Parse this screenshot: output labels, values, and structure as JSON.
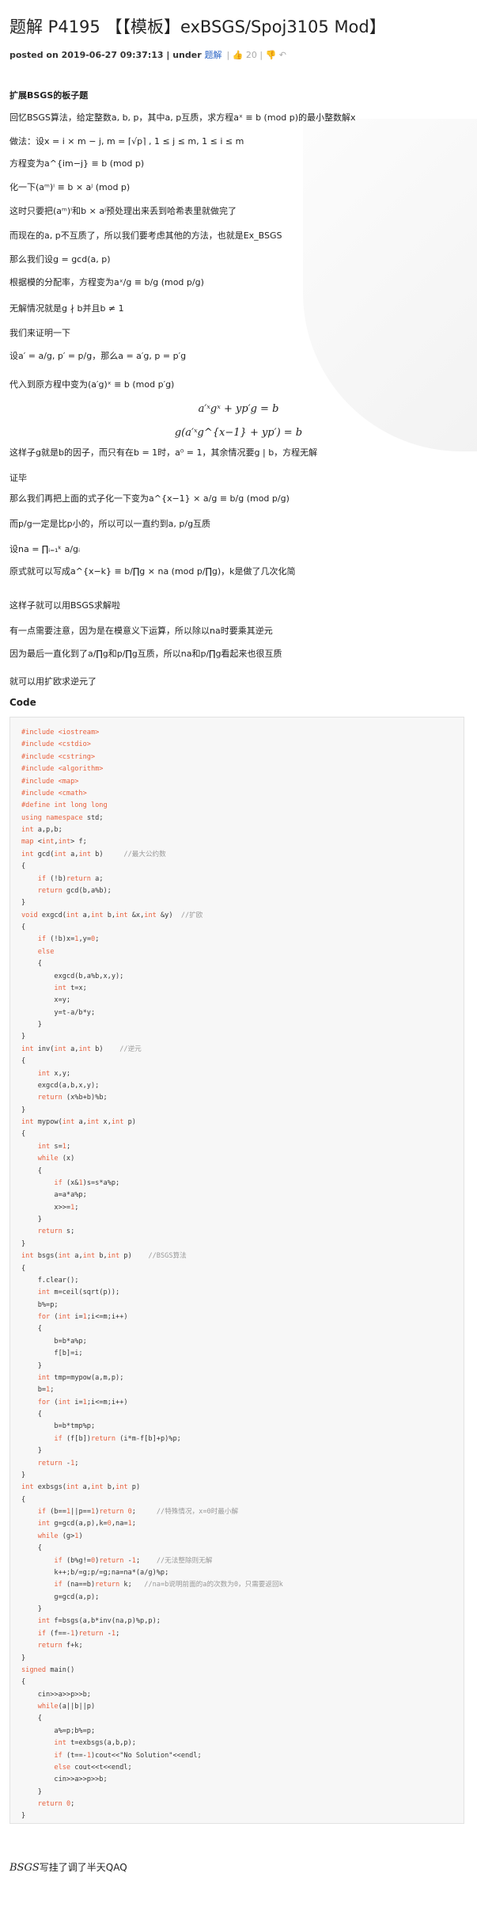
{
  "post": {
    "title": "题解 P4195 【【模板】exBSGS/Spoj3105 Mod】",
    "meta_posted": "posted on 2019-06-27 09:37:13 | under ",
    "meta_category": "题解",
    "meta_likes": "| 👍 20 | 👎 ↶"
  },
  "body": [
    {
      "text": "扩展BSGS的板子题",
      "bold": true
    },
    {
      "text": "回忆BSGS算法，给定整数a, b, p，其中a, p互质，求方程aˣ ≡ b (mod p)的最小整数解x"
    },
    {
      "text": "做法：设x = i × m − j, m = ⌈√p⌉ , 1 ≤ j ≤ m, 1 ≤ i ≤ m",
      "bold_prefix": "做法："
    },
    {
      "text": "方程变为a^{im−j} ≡ b (mod p)"
    },
    {
      "text": "化一下(aᵐ)ⁱ ≡ b × aʲ (mod p)"
    },
    {
      "text": "这时只要把(aᵐ)ⁱ和b × aʲ预处理出来丢到哈希表里就做完了"
    },
    {
      "text": "而现在的a, p不互质了，所以我们要考虑其他的方法，也就是Ex_BSGS"
    },
    {
      "text": "那么我们设g = gcd(a, p)"
    },
    {
      "text": "根据模的分配率，方程变为aˣ/g ≡ b/g (mod p/g)"
    },
    {
      "text": "无解情况就是g ∤ b并且b ≠ 1"
    },
    {
      "text": "我们来证明一下"
    },
    {
      "text": "设a′ = a/g, p′ = p/g，那么a = a′g, p = p′g"
    },
    {
      "text": "代入到原方程中变为(a′g)ˣ ≡ b (mod p′g)"
    },
    {
      "text": "a′ˣgˣ + yp′g = b",
      "center": true
    },
    {
      "text": "g(a′ˣg^{x−1} + yp′) = b",
      "center": true
    },
    {
      "text": "这样子g就是b的因子，而只有在b = 1时，a⁰ = 1，其余情况要g | b，方程无解"
    },
    {
      "text": "证毕"
    },
    {
      "text": "那么我们再把上面的式子化一下变为a^{x−1} × a/g ≡ b/g (mod p/g)"
    },
    {
      "text": "而p/g一定是比p小的，所以可以一直约到a, p/g互质"
    },
    {
      "text": "设na = ∏ᵢ₌₁ᵏ a/gᵢ"
    },
    {
      "text": "原式就可以写成a^{x−k} ≡ b/∏g × na (mod p/∏g)，k是做了几次化简"
    },
    {
      "text": "这样子就可以用BSGS求解啦"
    },
    {
      "text": "有一点需要注意，因为是在模意义下运算，所以除以na时要乘其逆元"
    },
    {
      "text": "因为最后一直化到了a/∏g和p/∏g互质，所以na和p/∏g看起来也很互质"
    },
    {
      "text": "就可以用扩欧求逆元了"
    }
  ],
  "code_heading": "Code",
  "code": [
    "#include <iostream>",
    "#include <cstdio>",
    "#include <cstring>",
    "#include <algorithm>",
    "#include <map>",
    "#include <cmath>",
    "#define int long long",
    "using namespace std;",
    "int a,p,b;",
    "map <int,int> f;",
    "int gcd(int a,int b)     //最大公约数",
    "{",
    "    if (!b)return a;",
    "    return gcd(b,a%b);",
    "}",
    "void exgcd(int a,int b,int &x,int &y)  //扩欧",
    "{",
    "    if (!b)x=1,y=0;",
    "    else",
    "    {",
    "        exgcd(b,a%b,x,y);",
    "        int t=x;",
    "        x=y;",
    "        y=t-a/b*y;",
    "    }",
    "}",
    "int inv(int a,int b)    //逆元",
    "{",
    "    int x,y;",
    "    exgcd(a,b,x,y);",
    "    return (x%b+b)%b;",
    "}",
    "int mypow(int a,int x,int p)",
    "{",
    "    int s=1;",
    "    while (x)",
    "    {",
    "        if (x&1)s=s*a%p;",
    "        a=a*a%p;",
    "        x>>=1;",
    "    }",
    "    return s;",
    "}",
    "int bsgs(int a,int b,int p)    //BSGS算法",
    "{",
    "    f.clear();",
    "    int m=ceil(sqrt(p));",
    "    b%=p;",
    "    for (int i=1;i<=m;i++)",
    "    {",
    "        b=b*a%p;",
    "        f[b]=i;",
    "    }",
    "    int tmp=mypow(a,m,p);",
    "    b=1;",
    "    for (int i=1;i<=m;i++)",
    "    {",
    "        b=b*tmp%p;",
    "        if (f[b])return (i*m-f[b]+p)%p;",
    "    }",
    "    return -1;",
    "}",
    "int exbsgs(int a,int b,int p)",
    "{",
    "    if (b==1||p==1)return 0;     //特殊情况，x=0时最小解",
    "    int g=gcd(a,p),k=0,na=1;",
    "    while (g>1)",
    "    {",
    "        if (b%g!=0)return -1;    //无法整除则无解",
    "        k++;b/=g;p/=g;na=na*(a/g)%p;",
    "        if (na==b)return k;   //na=b说明前面的a的次数为0，只需要返回k",
    "        g=gcd(a,p);",
    "    }",
    "    int f=bsgs(a,b*inv(na,p)%p,p);",
    "    if (f==-1)return -1;",
    "    return f+k;",
    "}",
    "signed main()",
    "{",
    "    cin>>a>>p>>b;",
    "    while(a||b||p)",
    "    {",
    "        a%=p;b%=p;",
    "        int t=exbsgs(a,b,p);",
    "        if (t==-1)cout<<\"No Solution\"<<endl;",
    "        else cout<<t<<endl;",
    "        cin>>a>>p>>b;",
    "    }",
    "    return 0;",
    "}"
  ],
  "footer": {
    "math": "BSGS",
    "text": "写挂了调了半天QAQ"
  },
  "colors": {
    "accent": "#2a64c5",
    "keyword": "#e8603c",
    "comment": "#999999",
    "code_bg": "#f7f7f7"
  }
}
